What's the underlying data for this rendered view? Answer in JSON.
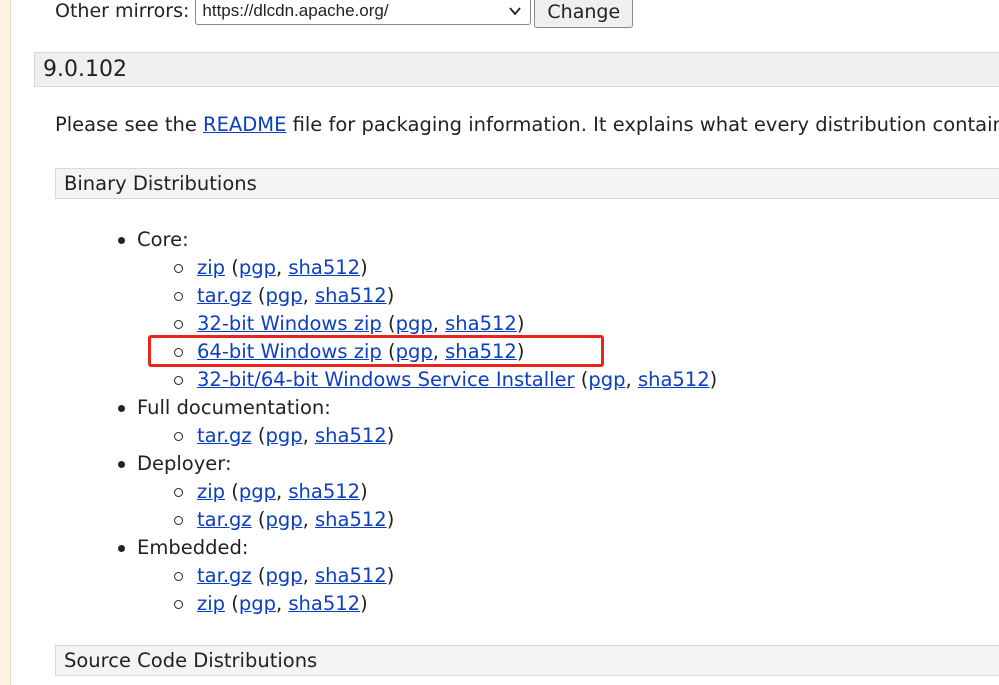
{
  "mirrors": {
    "label": "Other mirrors:",
    "selected": "https://dlcdn.apache.org/",
    "change_label": "Change"
  },
  "version": {
    "title": "9.0.102"
  },
  "intro": {
    "before": "Please see the ",
    "readme": "README",
    "after": " file for packaging information. It explains what every distribution contain"
  },
  "sections": {
    "binary": "Binary Distributions",
    "source": "Source Code Distributions"
  },
  "tree": [
    {
      "label": "Core:",
      "items": [
        {
          "name": "zip",
          "sig": "pgp",
          "hash": "sha512"
        },
        {
          "name": "tar.gz",
          "sig": "pgp",
          "hash": "sha512"
        },
        {
          "name": "32-bit Windows zip",
          "sig": "pgp",
          "hash": "sha512"
        },
        {
          "name": "64-bit Windows zip",
          "sig": "pgp",
          "hash": "sha512"
        },
        {
          "name": "32-bit/64-bit Windows Service Installer",
          "sig": "pgp",
          "hash": "sha512"
        }
      ]
    },
    {
      "label": "Full documentation:",
      "items": [
        {
          "name": "tar.gz",
          "sig": "pgp",
          "hash": "sha512"
        }
      ]
    },
    {
      "label": "Deployer:",
      "items": [
        {
          "name": "zip",
          "sig": "pgp",
          "hash": "sha512"
        },
        {
          "name": "tar.gz",
          "sig": "pgp",
          "hash": "sha512"
        }
      ]
    },
    {
      "label": "Embedded:",
      "items": [
        {
          "name": "tar.gz",
          "sig": "pgp",
          "hash": "sha512"
        },
        {
          "name": "zip",
          "sig": "pgp",
          "hash": "sha512"
        }
      ]
    }
  ],
  "colors": {
    "link": "#0c3ec1",
    "highlight": "#e8241d",
    "bar_bg": "#efefef"
  }
}
